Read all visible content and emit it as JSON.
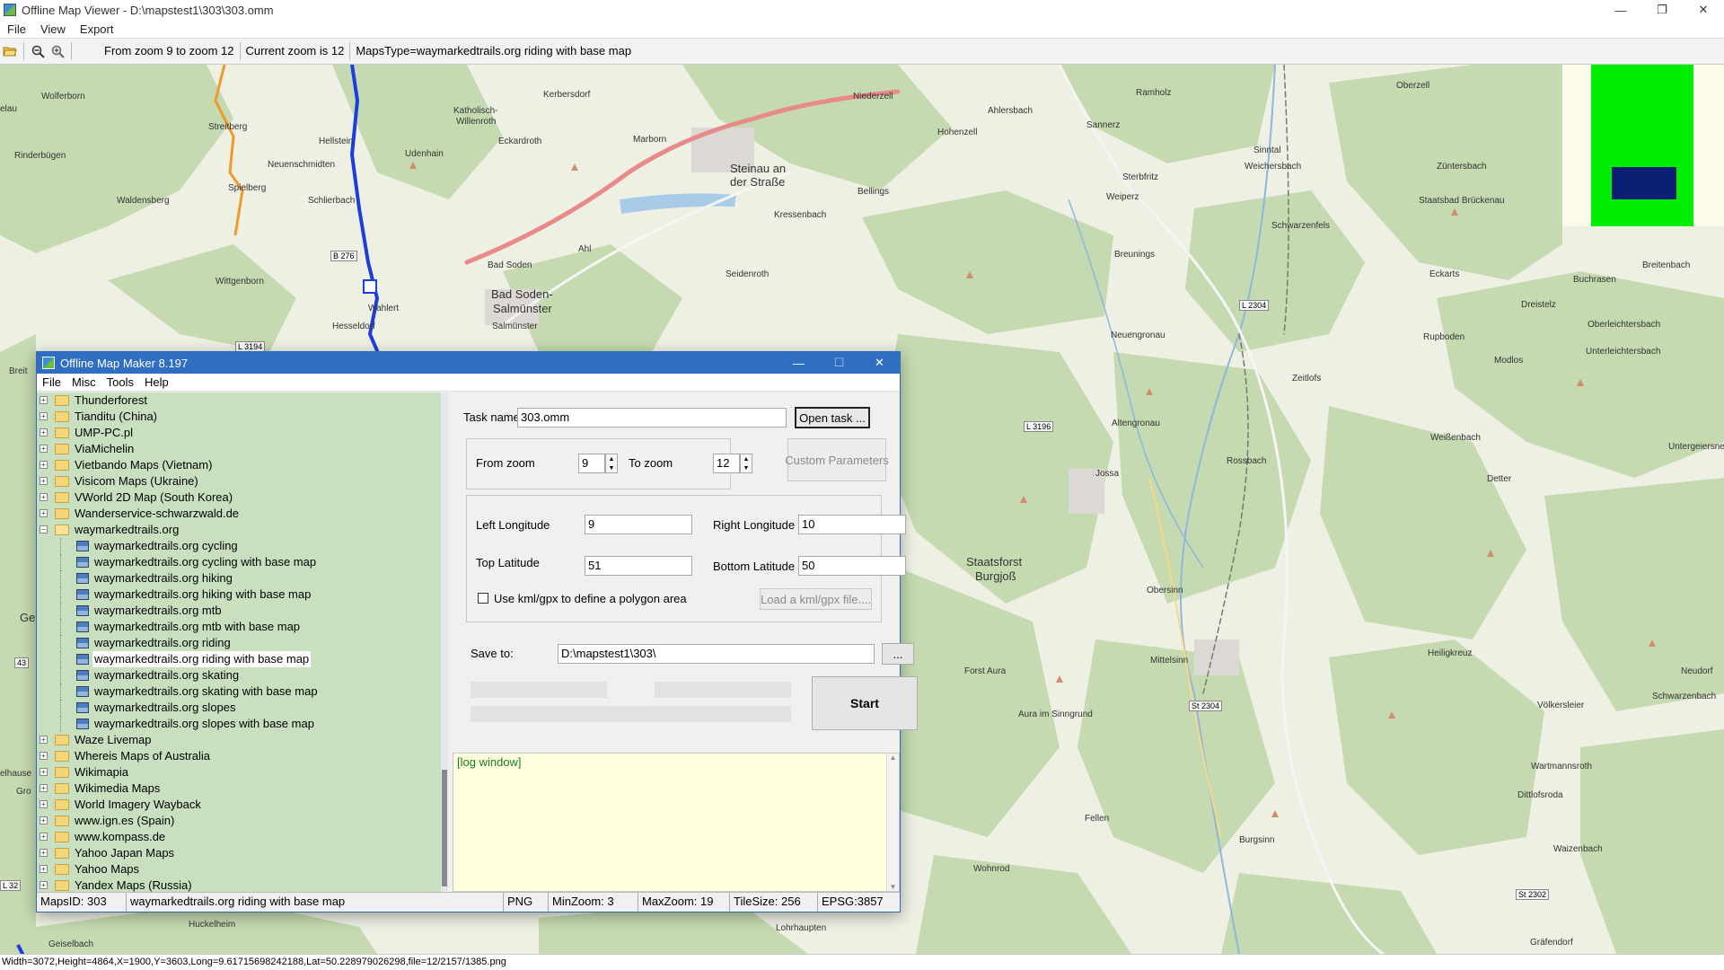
{
  "window": {
    "title": "Offline Map Viewer - D:\\mapstest1\\303\\303.omm",
    "minimize": "—",
    "maximize": "❐",
    "close": "✕"
  },
  "menu": [
    "File",
    "View",
    "Export"
  ],
  "toolbar": {
    "zoom_range": "From zoom 9 to zoom 12",
    "current_zoom": "Current zoom is 12",
    "maps_type": "MapsType=waymarkedtrails.org riding with base map",
    "open_icon": "folder-open-icon",
    "zoom_out_icon": "zoom-out-icon",
    "zoom_in_icon": "zoom-in-icon"
  },
  "map": {
    "places": [
      {
        "name": "elau",
        "big": false
      },
      {
        "name": "Wolferborn",
        "big": false
      },
      {
        "name": "Streitberg",
        "big": false
      },
      {
        "name": "Katholisch-",
        "big": false
      },
      {
        "name": "Willenroth",
        "big": false
      },
      {
        "name": "Kerbersdorf",
        "big": false
      },
      {
        "name": "Niederzell",
        "big": false
      },
      {
        "name": "Ahlersbach",
        "big": false
      },
      {
        "name": "Ramholz",
        "big": false
      },
      {
        "name": "Oberzell",
        "big": false
      },
      {
        "name": "Rinderbügen",
        "big": false
      },
      {
        "name": "Hellstein",
        "big": false
      },
      {
        "name": "Udenhain",
        "big": false
      },
      {
        "name": "Eckardroth",
        "big": false
      },
      {
        "name": "Marborn",
        "big": false
      },
      {
        "name": "Hohenzell",
        "big": false
      },
      {
        "name": "Sannerz",
        "big": false
      },
      {
        "name": "Neuenschmidten",
        "big": false
      },
      {
        "name": "Steinau an",
        "big": true
      },
      {
        "name": "der Straße",
        "big": true
      },
      {
        "name": "Sinntal",
        "big": false
      },
      {
        "name": "Weichersbach",
        "big": false
      },
      {
        "name": "Züntersbach",
        "big": false
      },
      {
        "name": "Waldensberg",
        "big": false
      },
      {
        "name": "Spielberg",
        "big": false
      },
      {
        "name": "Schlierbach",
        "big": false
      },
      {
        "name": "Kressenbach",
        "big": false
      },
      {
        "name": "Bellings",
        "big": false
      },
      {
        "name": "Sterbfritz",
        "big": false
      },
      {
        "name": "Weiperz",
        "big": false
      },
      {
        "name": "Staatsbad Brückenau",
        "big": false
      },
      {
        "name": "Schwarzenfels",
        "big": false
      },
      {
        "name": "Ahl",
        "big": false
      },
      {
        "name": "Bad Soden",
        "big": false
      },
      {
        "name": "Wittgenborn",
        "big": false
      },
      {
        "name": "Breunings",
        "big": false
      },
      {
        "name": "Seidenroth",
        "big": false
      },
      {
        "name": "Eckarts",
        "big": false
      },
      {
        "name": "Breitenbach",
        "big": false
      },
      {
        "name": "Bad Soden-",
        "big": true
      },
      {
        "name": "Salmünster",
        "big": true
      },
      {
        "name": "Buchrasen",
        "big": false
      },
      {
        "name": "Wahlert",
        "big": false
      },
      {
        "name": "Salmünster",
        "big": false
      },
      {
        "name": "Dreistelz",
        "big": false
      },
      {
        "name": "Hesseldorf",
        "big": false
      },
      {
        "name": "Oberleichtersbach",
        "big": false
      },
      {
        "name": "Neuengronau",
        "big": false
      },
      {
        "name": "Rupboden",
        "big": false
      },
      {
        "name": "Unterleichtersbach",
        "big": false
      },
      {
        "name": "Zeitlofs",
        "big": false
      },
      {
        "name": "Modlos",
        "big": false
      },
      {
        "name": "Altengronau",
        "big": false
      },
      {
        "name": "Weißenbach",
        "big": false
      },
      {
        "name": "Untergeiersne",
        "big": false
      },
      {
        "name": "Jossa",
        "big": false
      },
      {
        "name": "Rossbach",
        "big": false
      },
      {
        "name": "Detter",
        "big": false
      },
      {
        "name": "Staatsforst",
        "big": false
      },
      {
        "name": "Burgjoß",
        "big": false
      },
      {
        "name": "Obersinn",
        "big": false
      },
      {
        "name": "Heiligkreuz",
        "big": false
      },
      {
        "name": "Mittelsinn",
        "big": false
      },
      {
        "name": "Neudorf",
        "big": false
      },
      {
        "name": "Forst Aura",
        "big": false
      },
      {
        "name": "Schwarzenbach",
        "big": false
      },
      {
        "name": "Völkersleier",
        "big": false
      },
      {
        "name": "Aura im Sinngrund",
        "big": false
      },
      {
        "name": "Wartmannsroth",
        "big": false
      },
      {
        "name": "Dittlofsroda",
        "big": false
      },
      {
        "name": "Fellen",
        "big": false
      },
      {
        "name": "Burgsinn",
        "big": false
      },
      {
        "name": "Waizenbach",
        "big": false
      },
      {
        "name": "Wohnrod",
        "big": false
      },
      {
        "name": "Huckelheim",
        "big": false
      },
      {
        "name": "Lohrhaupten",
        "big": false
      },
      {
        "name": "Geiselbach",
        "big": false
      },
      {
        "name": "Gräfendorf",
        "big": false
      },
      {
        "name": "Ge",
        "big": true
      },
      {
        "name": "Breit",
        "big": false
      },
      {
        "name": "elhause",
        "big": false
      },
      {
        "name": "Gro",
        "big": false
      }
    ],
    "road_shields": [
      "B 276",
      "L 3194",
      "L 2304",
      "L 3196",
      "St 2304",
      "St 2302",
      "43",
      "L 32"
    ],
    "minimap_colors": {
      "background": "#fcfbea",
      "area": "#00ee00",
      "view": "#0a1e74"
    }
  },
  "status_bar": "Width=3072,Height=4864,X=1900,Y=3603,Long=9.61715698242188,Lat=50.228979026298,file=12/2157/1385.png",
  "dialog": {
    "title": "Offline Map Maker 8.197",
    "minimize": "—",
    "maximize": "☐",
    "close": "✕",
    "menu": [
      "File",
      "Misc",
      "Tools",
      "Help"
    ],
    "tree": [
      {
        "label": "Thunderforest",
        "type": "folder"
      },
      {
        "label": "Tianditu (China)",
        "type": "folder"
      },
      {
        "label": "UMP-PC.pl",
        "type": "folder"
      },
      {
        "label": "ViaMichelin",
        "type": "folder"
      },
      {
        "label": "Vietbando Maps (Vietnam)",
        "type": "folder"
      },
      {
        "label": "Visicom Maps (Ukraine)",
        "type": "folder"
      },
      {
        "label": "VWorld 2D Map (South Korea)",
        "type": "folder"
      },
      {
        "label": "Wanderservice-schwarzwald.de",
        "type": "folder"
      },
      {
        "label": "waymarkedtrails.org",
        "type": "open"
      },
      {
        "label": "waymarkedtrails.org cycling",
        "type": "child"
      },
      {
        "label": "waymarkedtrails.org cycling with base map",
        "type": "child"
      },
      {
        "label": "waymarkedtrails.org hiking",
        "type": "child"
      },
      {
        "label": "waymarkedtrails.org hiking with base map",
        "type": "child"
      },
      {
        "label": "waymarkedtrails.org mtb",
        "type": "child"
      },
      {
        "label": "waymarkedtrails.org mtb with base map",
        "type": "child"
      },
      {
        "label": "waymarkedtrails.org riding",
        "type": "child"
      },
      {
        "label": "waymarkedtrails.org riding with base map",
        "type": "child-selected"
      },
      {
        "label": "waymarkedtrails.org skating",
        "type": "child"
      },
      {
        "label": "waymarkedtrails.org skating with base map",
        "type": "child"
      },
      {
        "label": "waymarkedtrails.org slopes",
        "type": "child"
      },
      {
        "label": "waymarkedtrails.org slopes with base map",
        "type": "child"
      },
      {
        "label": "Waze Livemap",
        "type": "folder"
      },
      {
        "label": "Whereis Maps of Australia",
        "type": "folder"
      },
      {
        "label": "Wikimapia",
        "type": "folder"
      },
      {
        "label": "Wikimedia Maps",
        "type": "folder"
      },
      {
        "label": "World Imagery Wayback",
        "type": "folder"
      },
      {
        "label": "www.ign.es (Spain)",
        "type": "folder"
      },
      {
        "label": "www.kompass.de",
        "type": "folder"
      },
      {
        "label": "Yahoo Japan Maps",
        "type": "folder"
      },
      {
        "label": "Yahoo Maps",
        "type": "folder"
      },
      {
        "label": "Yandex Maps (Russia)",
        "type": "folder"
      }
    ],
    "form": {
      "task_name_label": "Task name",
      "task_name_value": "303.omm",
      "open_task": "Open task ...",
      "from_zoom_label": "From zoom",
      "from_zoom_value": "9",
      "to_zoom_label": "To zoom",
      "to_zoom_value": "12",
      "custom_parameters": "Custom Parameters",
      "left_lon_label": "Left Longitude",
      "left_lon_value": "9",
      "right_lon_label": "Right Longitude",
      "right_lon_value": "10",
      "top_lat_label": "Top Latitude",
      "top_lat_value": "51",
      "bottom_lat_label": "Bottom Latitude",
      "bottom_lat_value": "50",
      "kml_label": "Use kml/gpx to define a polygon area",
      "kml_checked": false,
      "load_kml": "Load a kml/gpx file....",
      "save_to_label": "Save to:",
      "save_to_value": "D:\\mapstest1\\303\\",
      "browse": "...",
      "start": "Start",
      "spin_up": "▲",
      "spin_down": "▼"
    },
    "log": "[log window]",
    "status": {
      "maps_id": "MapsID: 303",
      "maps_name": "waymarkedtrails.org riding with base map",
      "format": "PNG",
      "min_zoom": "MinZoom: 3",
      "max_zoom": "MaxZoom: 19",
      "tile_size": "TileSize: 256",
      "epsg": "EPSG:3857"
    }
  }
}
